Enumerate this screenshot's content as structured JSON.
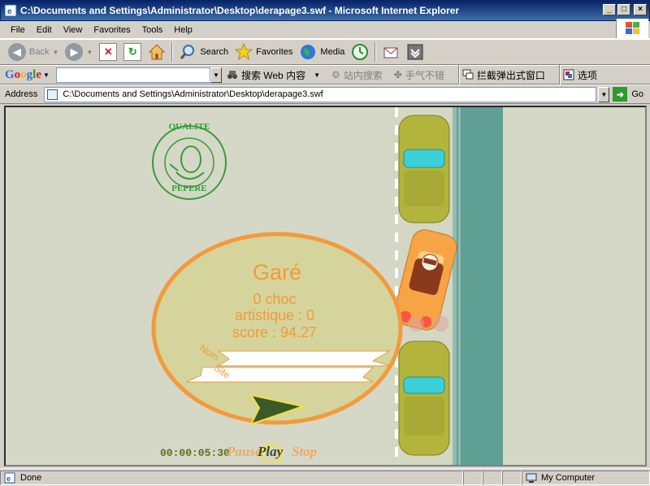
{
  "window": {
    "title": "C:\\Documents and Settings\\Administrator\\Desktop\\derapage3.swf - Microsoft Internet Explorer",
    "buttons": [
      "_",
      "□",
      "×"
    ]
  },
  "menu": [
    "File",
    "Edit",
    "View",
    "Favorites",
    "Tools",
    "Help"
  ],
  "toolbar": {
    "back": "Back",
    "search": "Search",
    "favorites": "Favorites",
    "media": "Media"
  },
  "googlebar": {
    "logo": "Google",
    "search_web": "搜索 Web 内容",
    "site_search": "站内搜索",
    "lucky": "手气不错",
    "popup_blocker": "拦截弹出式窗口",
    "options": "选项"
  },
  "address": {
    "label": "Address",
    "url": "C:\\Documents and Settings\\Administrator\\Desktop\\derapage3.swf",
    "go": "Go"
  },
  "game": {
    "stamp_top": "QUALITE",
    "stamp_bottom": "PEPERE",
    "result": "Garé",
    "chocs": "0 choc",
    "artistique": "artistique : 0",
    "score": "score : 94.27",
    "name_label": "Nom",
    "site_label": "Site",
    "time": "00:00:05:30",
    "pause": "Pause",
    "play": "Play",
    "stop": "Stop"
  },
  "status": {
    "left": "Done",
    "zone": "My Computer"
  },
  "colors": {
    "accent": "#f29a3c",
    "background": "#d5d8c7",
    "curb": "#5f9f94",
    "parked_car": "#b3b43b",
    "player_car": "#f6a445"
  }
}
